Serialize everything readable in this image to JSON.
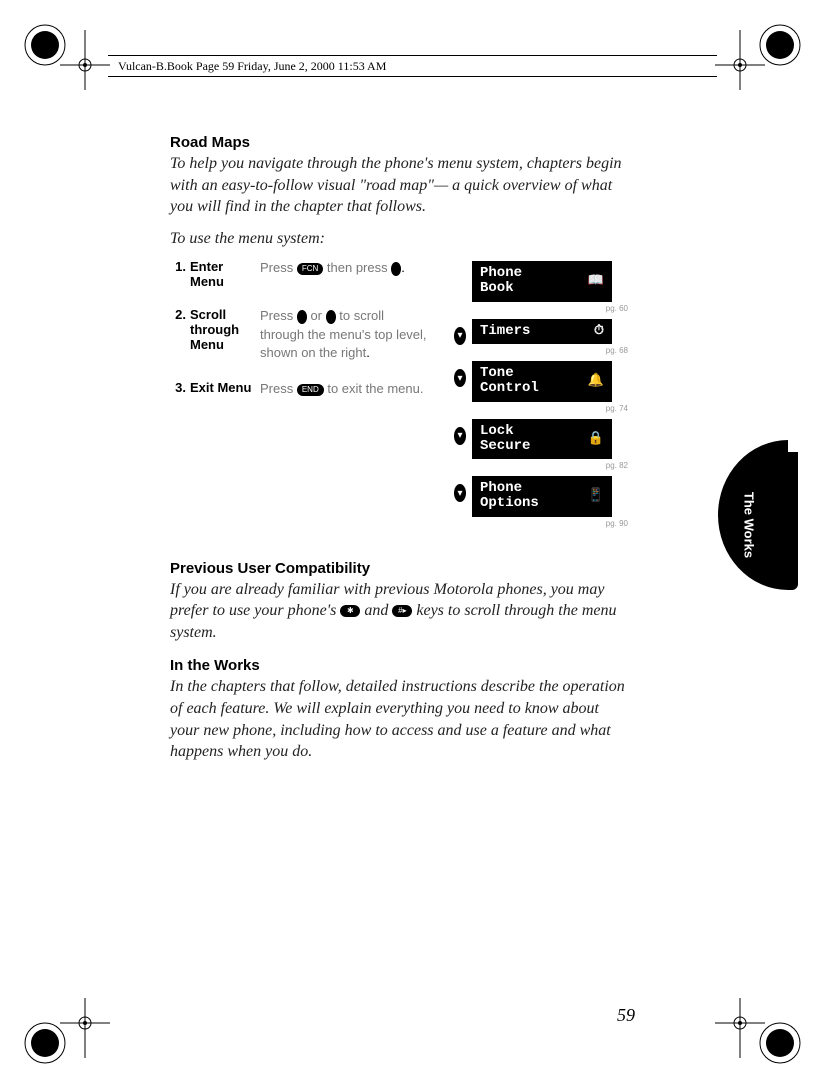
{
  "header": "Vulcan-B.Book  Page 59  Friday, June 2, 2000  11:53 AM",
  "roadmaps": {
    "heading": "Road Maps",
    "para": "To help you navigate through the phone's menu system, chapters begin with an easy-to-follow visual \"road map\"— a quick overview of what you will find in the chapter that follows.",
    "lead": "To use the menu system:"
  },
  "steps": [
    {
      "num": "1.",
      "label": "Enter Menu",
      "pre": "Press ",
      "mid": " then press ",
      "post": ".",
      "key1": "FCN",
      "key2_is_dot": true
    },
    {
      "num": "2.",
      "label": "Scroll through Menu",
      "pre": "Press ",
      "mid": " or ",
      "post": " to scroll through the menu's top level, shown on the right",
      "punct_post": ".",
      "key1_is_dot": true,
      "key2_is_dot": true
    },
    {
      "num": "3.",
      "label": "Exit Menu",
      "pre": "Press ",
      "mid": " to exit the menu.",
      "key1": "END"
    }
  ],
  "menu_items": [
    {
      "text": "Phone\nBook",
      "icon": "📖",
      "pg": "pg. 60",
      "arrow": false
    },
    {
      "text": "Timers",
      "icon": "⏱",
      "pg": "pg. 68",
      "arrow": true
    },
    {
      "text": "Tone\nControl",
      "icon": "🔔",
      "pg": "pg. 74",
      "arrow": true
    },
    {
      "text": "Lock\nSecure",
      "icon": "🔒",
      "pg": "pg. 82",
      "arrow": true
    },
    {
      "text": "Phone\nOptions",
      "icon": "📱",
      "pg": "pg. 90",
      "arrow": true
    }
  ],
  "compat": {
    "heading": "Previous User Compatibility",
    "para_pre": "If you are already familiar with previous Motorola phones, you may prefer to use your phone's ",
    "key1": "✱",
    "mid": " and ",
    "key2": "#▸",
    "para_post": " keys to scroll through the menu system."
  },
  "works": {
    "heading": "In the Works",
    "para": "In the chapters that follow, detailed instructions describe the operation of each feature. We will explain everything you need to know about your new phone, including how to access and use a feature and what happens when you do."
  },
  "side_tab": "The Works",
  "page_number": "59"
}
